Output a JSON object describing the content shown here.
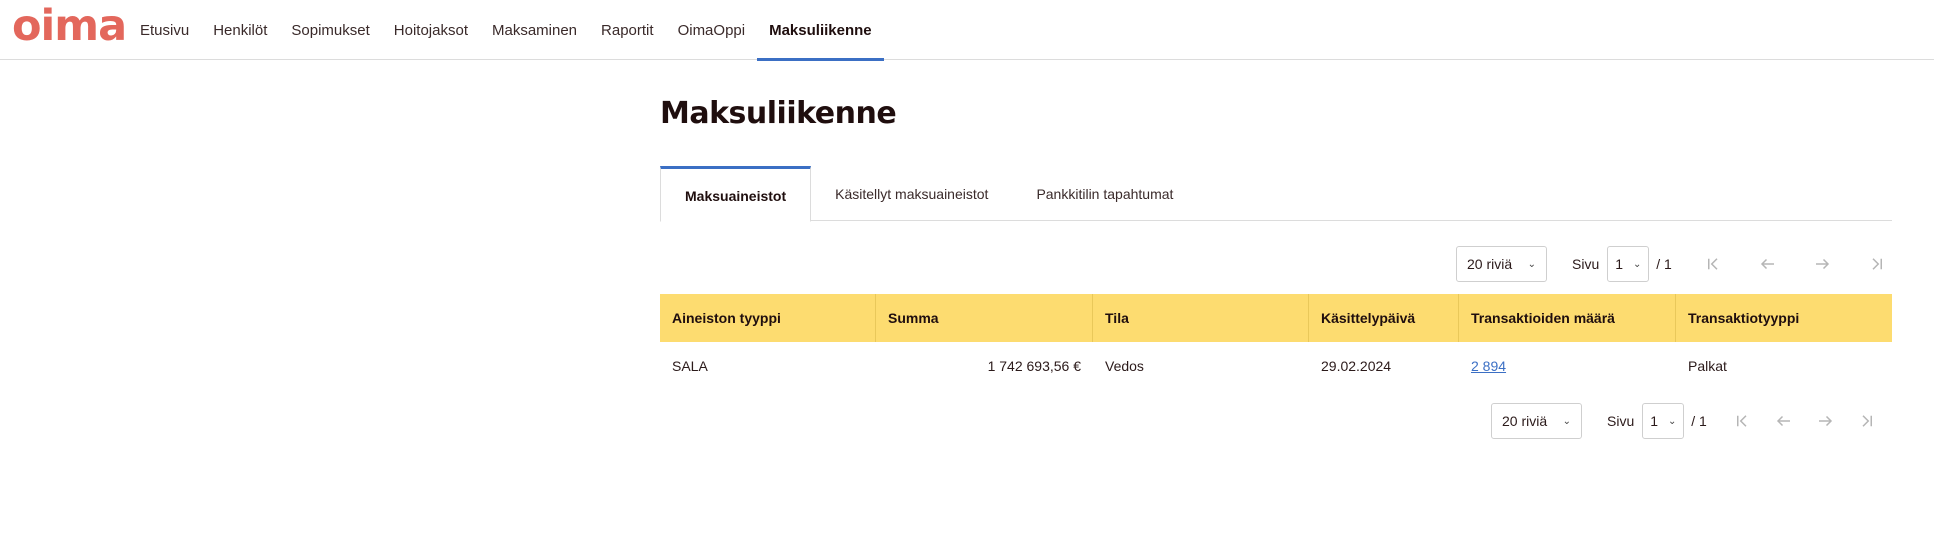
{
  "app": {
    "logo_text": "oima",
    "brand_color": "#e3675c",
    "accent_color": "#3b6fc4",
    "header_bg": "#fddc70"
  },
  "nav": {
    "items": [
      {
        "label": "Etusivu"
      },
      {
        "label": "Henkilöt"
      },
      {
        "label": "Sopimukset"
      },
      {
        "label": "Hoitojaksot"
      },
      {
        "label": "Maksaminen"
      },
      {
        "label": "Raportit"
      },
      {
        "label": "OimaOppi"
      },
      {
        "label": "Maksuliikenne",
        "active": true
      }
    ]
  },
  "page": {
    "title": "Maksuliikenne"
  },
  "tabs": [
    {
      "label": "Maksuaineistot",
      "active": true
    },
    {
      "label": "Käsitellyt maksuaineistot"
    },
    {
      "label": "Pankkitilin tapahtumat"
    }
  ],
  "pagination": {
    "rows_per_page": "20 riviä",
    "page_label": "Sivu",
    "current_page": "1",
    "total_pages": "/ 1",
    "icons": [
      "first-page-icon",
      "prev-page-icon",
      "next-page-icon",
      "last-page-icon"
    ]
  },
  "table": {
    "columns": [
      "Aineiston tyyppi",
      "Summa",
      "Tila",
      "Käsittelypäivä",
      "Transaktioiden määrä",
      "Transaktiotyyppi"
    ],
    "rows": [
      {
        "type": "SALA",
        "amount": "1 742 693,56 €",
        "status": "Vedos",
        "date": "29.02.2024",
        "count": "2 894",
        "txtype": "Palkat"
      }
    ]
  }
}
